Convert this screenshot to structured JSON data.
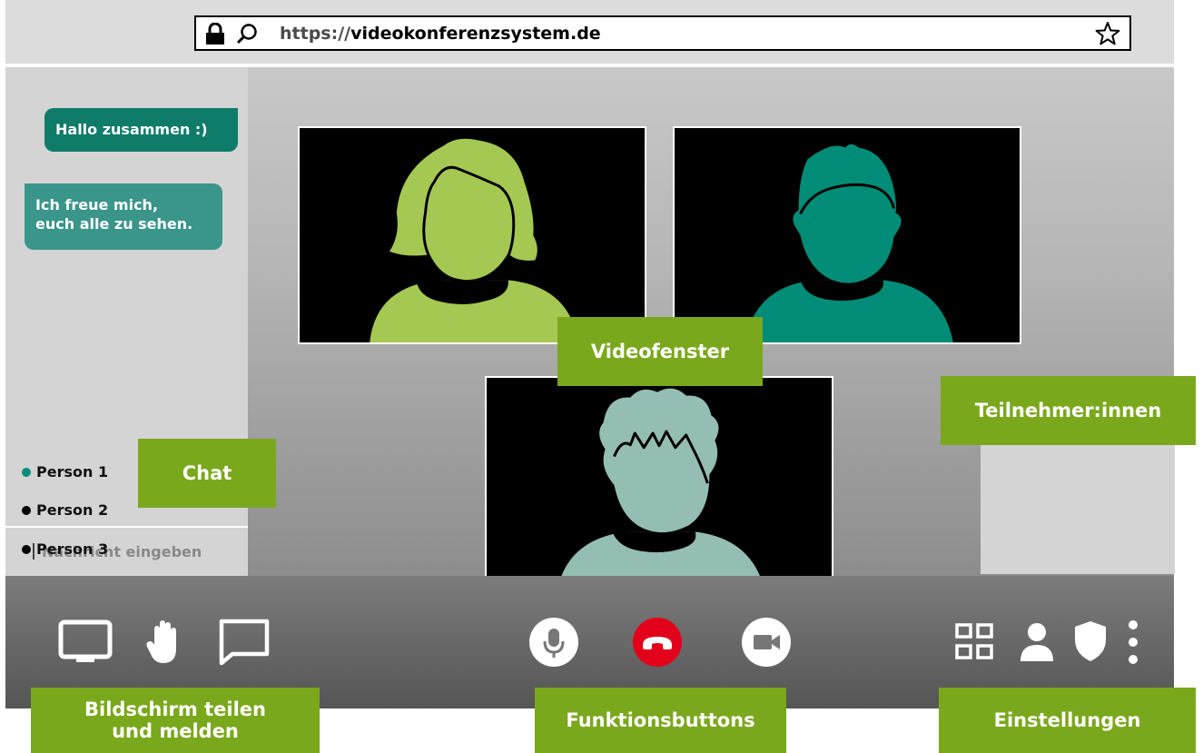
{
  "browser": {
    "url_protocol": "https://",
    "url_host": "videokonferenzsystem.de"
  },
  "chat": {
    "messages": [
      {
        "text": "Hallo zusammen :)"
      },
      {
        "line1": "Ich freue mich,",
        "line2": "euch alle zu sehen."
      }
    ],
    "input_placeholder": "Nachricht eingeben"
  },
  "videos": [
    {
      "color": "#a5c852",
      "hair": "long"
    },
    {
      "color": "#008c77",
      "hair": "short"
    },
    {
      "color": "#94bdb3",
      "hair": "curly"
    }
  ],
  "participants": [
    {
      "name": "Person 1",
      "status_color": "#0a8c78"
    },
    {
      "name": "Person 2",
      "status_color": "#000000"
    },
    {
      "name": "Person 3",
      "status_color": "#000000"
    }
  ],
  "labels": {
    "video": "Videofenster",
    "chat": "Chat",
    "participants": "Teilnehmer:innen",
    "share_line1": "Bildschirm teilen",
    "share_line2": "und melden",
    "functions": "Funktionsbuttons",
    "settings": "Einstellungen"
  },
  "toolbar": {
    "icons_left": [
      "screen-share-icon",
      "raise-hand-icon",
      "chat-icon"
    ],
    "icons_center": [
      "microphone-icon",
      "hang-up-icon",
      "camera-icon"
    ],
    "icons_right": [
      "grid-view-icon",
      "user-icon",
      "shield-icon",
      "more-icon"
    ],
    "hangup_color": "#e2001a"
  },
  "colors": {
    "label_green": "#7aa81c",
    "chat_bubble_dark": "#0f7c6a",
    "chat_bubble_light": "#3a958a"
  }
}
